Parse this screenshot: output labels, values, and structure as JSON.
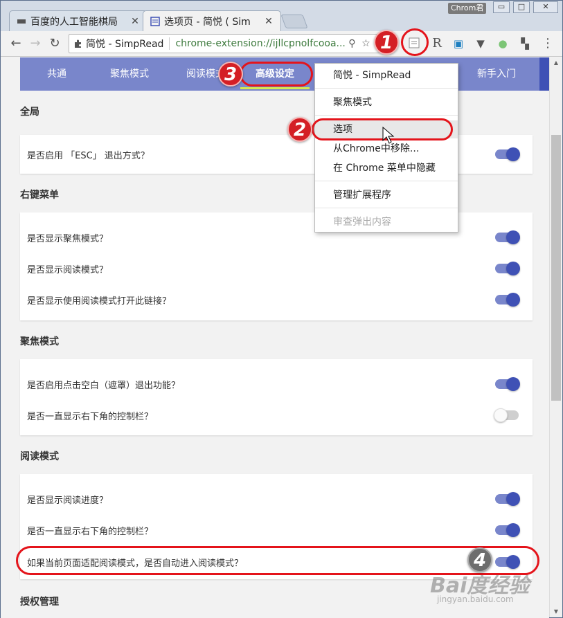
{
  "browser": {
    "profile_badge": "Chrom君",
    "window_controls": {
      "minimize": "▭",
      "maximize": "□",
      "close": "✕"
    },
    "tabs": [
      {
        "title": "百度的人工智能棋局",
        "close": "✕"
      },
      {
        "title": "选项页 - 简悦 ( Sim",
        "close": "✕"
      }
    ],
    "nav": {
      "back": "←",
      "forward": "→",
      "reload": "↻"
    },
    "omnibox": {
      "ext_name": "简悦 - SimpRead",
      "url": "chrome-extension://ijllcpnolfcooa...",
      "zoom_icon": "⚲",
      "star_icon": "☆"
    },
    "extension_icons": [
      "R",
      "▣",
      "▼",
      "●",
      "▚",
      "⋮"
    ]
  },
  "options": {
    "nav_items": [
      "共通",
      "聚焦模式",
      "阅读模式",
      "高级设定",
      "新手入门"
    ],
    "active_nav": "高级设定",
    "sections": [
      {
        "title": "全局",
        "rows": [
          {
            "label": "是否启用 「ESC」 退出方式？",
            "on": true
          }
        ]
      },
      {
        "title": "右键菜单",
        "rows": [
          {
            "label": "是否显示聚焦模式？",
            "on": true
          },
          {
            "label": "是否显示阅读模式？",
            "on": true
          },
          {
            "label": "是否显示使用阅读模式打开此链接？",
            "on": true
          }
        ]
      },
      {
        "title": "聚焦模式",
        "rows": [
          {
            "label": "是否启用点击空白（遮罩）退出功能？",
            "on": true
          },
          {
            "label": "是否一直显示右下角的控制栏？",
            "on": false
          }
        ]
      },
      {
        "title": "阅读模式",
        "rows": [
          {
            "label": "是否显示阅读进度？",
            "on": true
          },
          {
            "label": "是否一直显示右下角的控制栏？",
            "on": true
          },
          {
            "label": "如果当前页面适配阅读模式，是否自动进入阅读模式？",
            "on": true
          }
        ]
      },
      {
        "title": "授权管理",
        "rows": []
      }
    ]
  },
  "context_menu": {
    "items": [
      "简悦 - SimpRead",
      "聚焦模式",
      "选项",
      "从Chrome中移除...",
      "在 Chrome 菜单中隐藏",
      "管理扩展程序",
      "审查弹出内容"
    ],
    "highlighted": "选项",
    "disabled": "审查弹出内容"
  },
  "annotations": {
    "steps": [
      "1",
      "2",
      "3",
      "4"
    ]
  },
  "watermark": {
    "brand": "Bai度经验",
    "url": "jingyan.baidu.com"
  },
  "colors": {
    "accent": "#3f51b5",
    "nav_bg": "#7986cb",
    "highlight_underline": "#d6e94f",
    "annotation_red": "#e4141b"
  }
}
